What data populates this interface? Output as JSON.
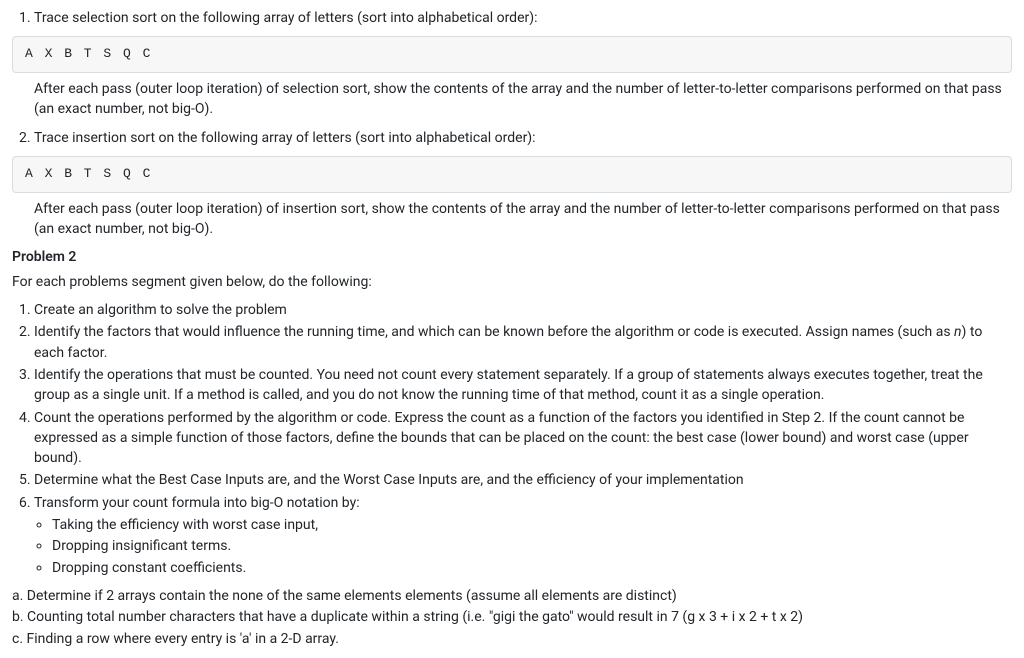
{
  "p1": {
    "item1_text": "Trace selection sort on the following array of letters (sort into alphabetical order):",
    "code1": "A X B T S Q C",
    "after1": "After each pass (outer loop iteration) of selection sort, show the contents of the array and the number of letter-to-letter comparisons performed on that pass (an exact number, not big-O).",
    "item2_text": "Trace insertion sort on the following array of letters (sort into alphabetical order):",
    "code2": "A X B T S Q C",
    "after2": "After each pass (outer loop iteration) of insertion sort, show the contents of the array and the number of letter-to-letter comparisons performed on that pass (an exact number, not big-O)."
  },
  "p2": {
    "heading": "Problem 2",
    "intro": "For each problems segment given below, do the following:",
    "steps": {
      "s1": "Create an algorithm to solve the problem",
      "s2_pre": "Identify the factors that would influence the running time, and which can be known before the algorithm or code is executed. Assign names (such as ",
      "s2_n": "n",
      "s2_post": ") to each factor.",
      "s3": "Identify the operations that must be counted. You need not count every statement separately. If a group of statements always executes together, treat the group as a single unit. If a method is called, and you do not know the running time of that method, count it as a single operation.",
      "s4": "Count the operations performed by the algorithm or code. Express the count as a function of the factors you identified in Step 2. If the count cannot be expressed as a simple function of those factors, define the bounds that can be placed on the count: the best case (lower bound) and worst case (upper bound).",
      "s5": "Determine what the Best Case Inputs are, and the Worst Case Inputs are, and the efficiency of your implementation",
      "s6": "Transform your count formula into big-O notation by:",
      "s6a": "Taking the efficiency with worst case input,",
      "s6b": "Dropping insignificant terms.",
      "s6c": "Dropping constant coefficients."
    },
    "tasks": {
      "a": "a. Determine if 2 arrays contain the none of the same elements elements (assume all elements are distinct)",
      "b": "b. Counting total number characters that have a duplicate within a string (i.e. \"gigi the gato\" would result in 7 (g x 3 + i x 2 + t x 2)",
      "c": "c. Finding a row where every entry is 'a' in a 2-D array."
    }
  }
}
